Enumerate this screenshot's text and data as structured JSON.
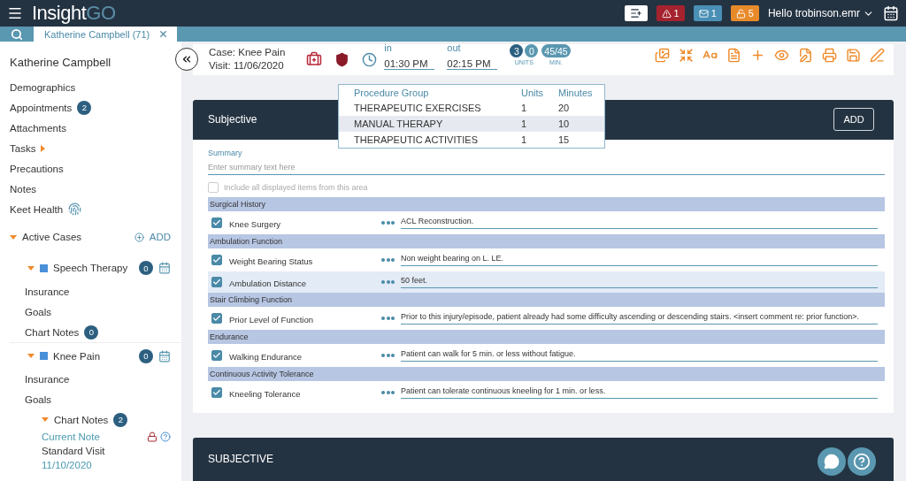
{
  "header": {
    "brand_main": "Insight",
    "brand_accent": "GO",
    "badges": [
      {
        "kind": "alert",
        "text": "1"
      },
      {
        "kind": "mail",
        "text": "1"
      },
      {
        "kind": "lock",
        "text": "5"
      }
    ],
    "user": "Hello trobinson.emr"
  },
  "tab": {
    "label": "Katherine Campbell (71)"
  },
  "sidebar": {
    "patient": "Katherine Campbell",
    "items": [
      {
        "kind": "plain",
        "label": "Demographics"
      },
      {
        "kind": "count",
        "label": "Appointments",
        "badge": "2"
      },
      {
        "kind": "plain",
        "label": "Attachments"
      },
      {
        "kind": "caret",
        "label": "Tasks"
      },
      {
        "kind": "plain",
        "label": "Precautions"
      },
      {
        "kind": "plain",
        "label": "Notes"
      },
      {
        "kind": "fingerprint",
        "label": "Keet Health"
      }
    ],
    "active_cases": {
      "label": "Active Cases",
      "add": "ADD",
      "expanded": true,
      "cases": [
        {
          "name": "Speech Therapy",
          "count": "0",
          "expanded": true,
          "children": [
            {
              "label": "Insurance"
            },
            {
              "label": "Goals"
            },
            {
              "label": "Chart Notes",
              "badge": "0"
            }
          ]
        },
        {
          "name": "Knee Pain",
          "count": "0",
          "expanded": true,
          "children": [
            {
              "label": "Insurance"
            },
            {
              "label": "Goals"
            },
            {
              "label": "Chart Notes",
              "badge": "2",
              "expanded": true,
              "note": {
                "title": "Current Note",
                "type": "Standard Visit",
                "date": "11/10/2020"
              }
            }
          ]
        }
      ]
    }
  },
  "case_bar": {
    "case": "Case: Knee Pain",
    "visit": "Visit: 11/06/2020",
    "in_label": "in",
    "in_time": "01:30 PM",
    "out_label": "out",
    "out_time": "02:15 PM",
    "units": [
      "3",
      "0"
    ],
    "units_label": "UNITS",
    "minutes": "45/45",
    "minutes_label": "MIN."
  },
  "procedures": {
    "columns": [
      "Procedure Group",
      "Units",
      "Minutes"
    ],
    "rows": [
      {
        "cells": [
          "THERAPEUTIC EXERCISES",
          "1",
          "20"
        ],
        "selected": false
      },
      {
        "cells": [
          "MANUAL THERAPY",
          "1",
          "10"
        ],
        "selected": true
      },
      {
        "cells": [
          "THERAPEUTIC ACTIVITIES",
          "1",
          "15"
        ],
        "selected": false
      }
    ]
  },
  "subjective": {
    "title": "Subjective",
    "add": "ADD",
    "summary_label": "Summary",
    "summary_placeholder": "Enter summary text here",
    "include_label": "Include all displayed items from this area",
    "include_checked": false,
    "sections": [
      {
        "title": "Surgical History",
        "items": [
          {
            "label": "Knee Surgery",
            "checked": true,
            "value": "ACL Reconstruction.",
            "selected": false
          }
        ]
      },
      {
        "title": "Ambulation Function",
        "items": [
          {
            "label": "Weight Bearing Status",
            "checked": true,
            "value": "Non weight bearing on L. LE.",
            "selected": false
          },
          {
            "label": "Ambulation Distance",
            "checked": true,
            "value": " 50 feet.",
            "selected": true
          }
        ]
      },
      {
        "title": "Stair Climbing Function",
        "items": [
          {
            "label": "Prior Level of Function",
            "checked": true,
            "value": "Prior to this injury/episode, patient already had some difficulty ascending or descending stairs. <insert comment re: prior function>.",
            "selected": false
          }
        ]
      },
      {
        "title": "Endurance",
        "items": [
          {
            "label": "Walking Endurance",
            "checked": true,
            "value": "Patient can walk for 5 min. or less without fatigue.",
            "selected": false
          }
        ]
      },
      {
        "title": "Continuous Activity Tolerance",
        "items": [
          {
            "label": "Kneeling Tolerance",
            "checked": true,
            "value": "Patient can tolerate continuous kneeling for 1 min. or less.",
            "selected": false
          }
        ]
      }
    ]
  },
  "second_card": {
    "title": "SUBJECTIVE"
  }
}
